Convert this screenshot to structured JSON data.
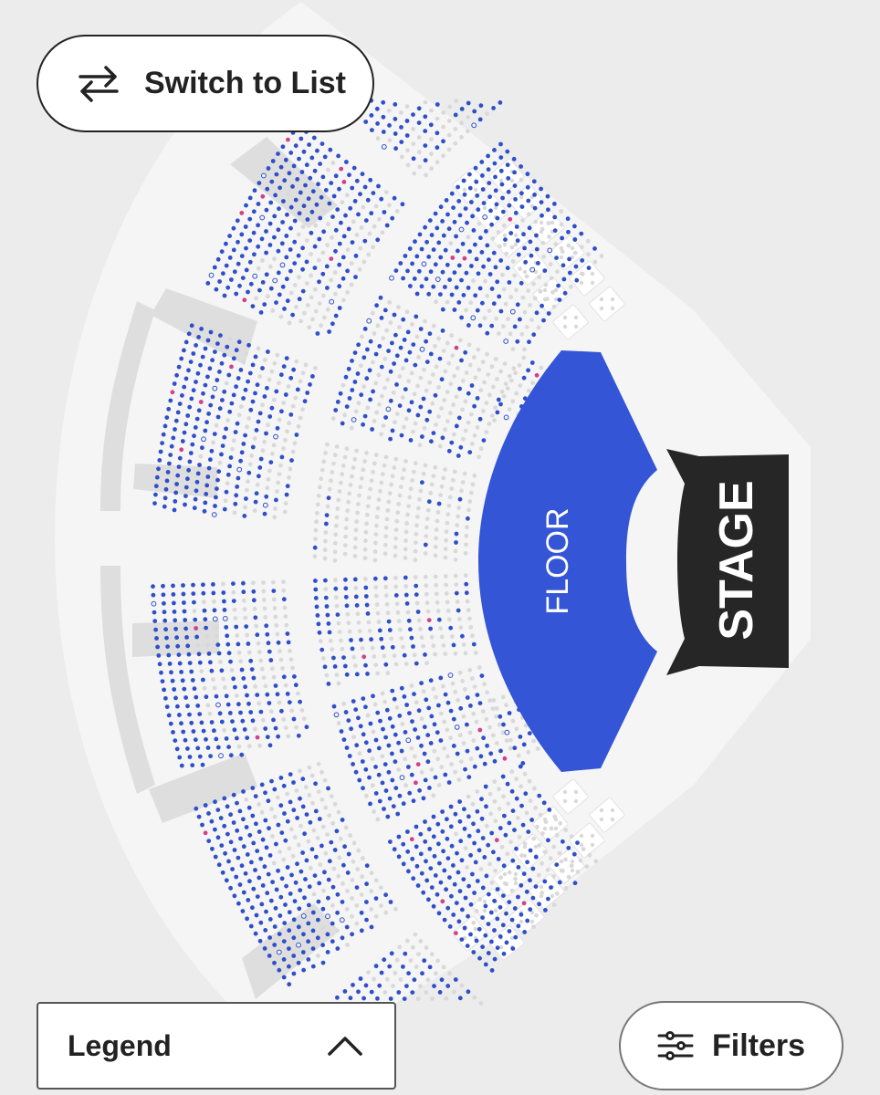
{
  "toolbar": {
    "switch_label": "Switch to List",
    "legend_label": "Legend",
    "filters_label": "Filters"
  },
  "map": {
    "floor_label": "FLOOR",
    "stage_label": "STAGE"
  },
  "icons": {
    "switch": "swap-arrows-icon",
    "legend_toggle": "chevron-up-icon",
    "filters": "sliders-icon"
  },
  "colors": {
    "available_seat": "#2f4fc9",
    "highlighted_seat": "#d1408a",
    "unavailable_seat": "#d9d9d9",
    "floor": "#3355d6",
    "stage": "#262626",
    "venue_background": "#f5f5f5",
    "aisle": "#dedede"
  }
}
